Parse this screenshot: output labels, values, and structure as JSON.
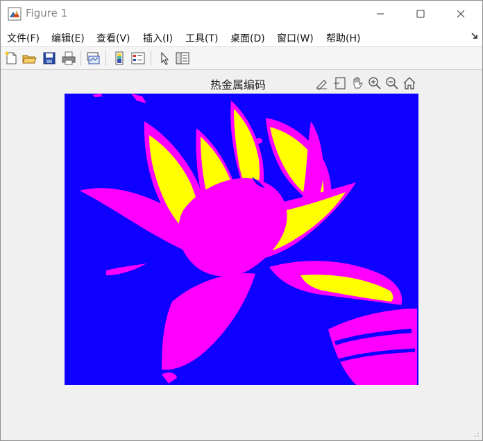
{
  "window": {
    "title": "Figure 1",
    "title_icon": "matlab-logo-icon"
  },
  "titlebar_buttons": {
    "minimize_icon": "minimize-icon",
    "maximize_icon": "maximize-icon",
    "close_icon": "close-icon"
  },
  "menubar": {
    "items": [
      {
        "label": "文件(F)"
      },
      {
        "label": "编辑(E)"
      },
      {
        "label": "查看(V)"
      },
      {
        "label": "插入(I)"
      },
      {
        "label": "工具(T)"
      },
      {
        "label": "桌面(D)"
      },
      {
        "label": "窗口(W)"
      },
      {
        "label": "帮助(H)"
      }
    ],
    "dock_icon": "dock-arrow-icon"
  },
  "toolbar": {
    "buttons": [
      {
        "icon": "new-figure-icon"
      },
      {
        "icon": "open-file-icon"
      },
      {
        "icon": "save-icon"
      },
      {
        "icon": "print-icon"
      },
      {
        "icon": "link-plot-icon"
      },
      {
        "icon": "insert-colorbar-icon"
      },
      {
        "icon": "insert-legend-icon"
      },
      {
        "icon": "edit-plot-pointer-icon"
      },
      {
        "icon": "property-inspector-icon"
      }
    ]
  },
  "axes": {
    "title": "热金属编码",
    "toolbar_icons": [
      "brush-icon",
      "data-tips-icon",
      "pan-hand-icon",
      "zoom-in-icon",
      "zoom-out-icon",
      "home-icon"
    ]
  },
  "image": {
    "description_colors": {
      "background": "#0d00ff",
      "petal_primary": "#ff00ff",
      "petal_highlight": "#ffff00"
    }
  }
}
